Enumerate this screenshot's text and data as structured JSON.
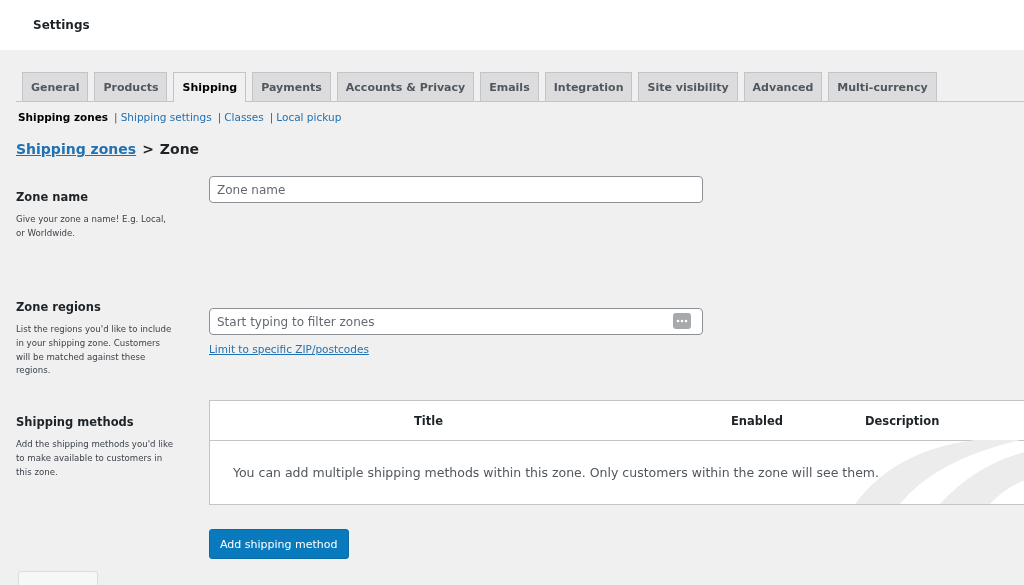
{
  "header": {
    "title": "Settings"
  },
  "tabs": [
    {
      "label": "General",
      "selected": false
    },
    {
      "label": "Products",
      "selected": false
    },
    {
      "label": "Shipping",
      "selected": true
    },
    {
      "label": "Payments",
      "selected": false
    },
    {
      "label": "Accounts & Privacy",
      "selected": false
    },
    {
      "label": "Emails",
      "selected": false
    },
    {
      "label": "Integration",
      "selected": false
    },
    {
      "label": "Site visibility",
      "selected": false
    },
    {
      "label": "Advanced",
      "selected": false
    },
    {
      "label": "Multi-currency",
      "selected": false
    }
  ],
  "subnav": [
    {
      "label": "Shipping zones",
      "selected": true
    },
    {
      "separator": "|",
      "label": "Shipping settings",
      "selected": false
    },
    {
      "separator": "|",
      "label": "Classes",
      "selected": false
    },
    {
      "separator": "|",
      "label": "Local pickup",
      "selected": false
    }
  ],
  "breadcrumb": {
    "link": "Shipping zones",
    "separator": ">",
    "current": "Zone"
  },
  "zone_name": {
    "label": "Zone name",
    "description": "Give your zone a name! E.g. Local, or Worldwide.",
    "placeholder": "Zone name"
  },
  "zone_regions": {
    "label": "Zone regions",
    "description": "List the regions you'd like to include in your shipping zone. Customers will be matched against these regions.",
    "placeholder": "Start typing to filter zones",
    "link": "Limit to specific ZIP/postcodes"
  },
  "shipping_methods": {
    "label": "Shipping methods",
    "description": "Add the shipping methods you'd like to make available to customers in this zone.",
    "columns": [
      "Title",
      "Enabled",
      "Description"
    ],
    "empty_message": "You can add multiple shipping methods within this zone. Only customers within the zone will see them.",
    "button": "Add shipping method"
  }
}
